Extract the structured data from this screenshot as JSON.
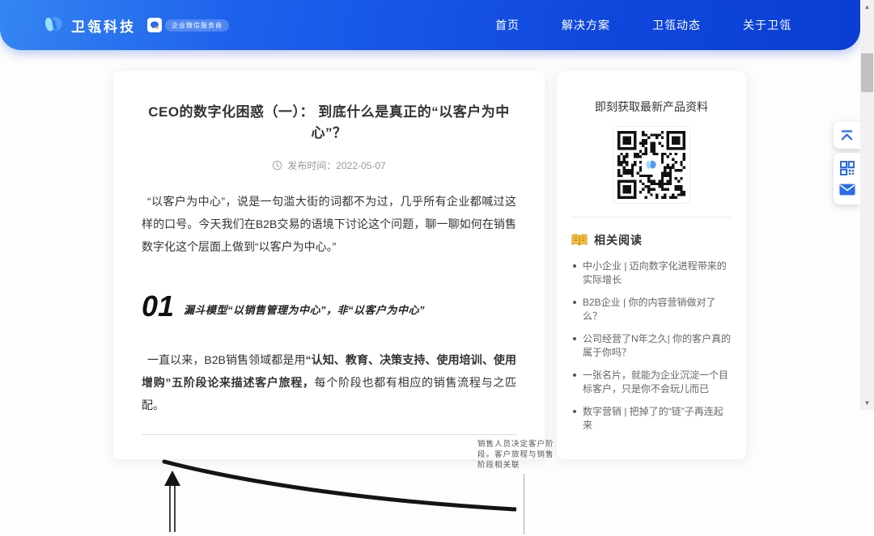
{
  "colors": {
    "header_gradient_start": "#3585f2",
    "header_gradient_end": "#0a3ed4",
    "accent_blue": "#2a6cea",
    "book_icon_gold": "#e8b339",
    "text_dark": "#333333",
    "text_gray": "#666666",
    "text_light": "#999999"
  },
  "icons": {
    "logo": "weiling-wing-mark",
    "badge": "wechat-work-bubble",
    "clock": "clock-outline",
    "book": "open-book",
    "qr": "qr-grid",
    "mail": "envelope",
    "back_top": "chevron-up-to-line",
    "scroll_up": "▲",
    "scroll_down": "▼"
  },
  "header": {
    "brand": "卫瓴科技",
    "badge": "企业微信服务商",
    "nav": [
      {
        "label": "首页"
      },
      {
        "label": "解决方案"
      },
      {
        "label": "卫瓴动态"
      },
      {
        "label": "关于卫瓴"
      }
    ]
  },
  "article": {
    "title": "CEO的数字化困惑（一）： 到底什么是真正的“以客户为中心”？",
    "publish_label": "发布时间：2022-05-07",
    "para1": "“以客户为中心”，说是一句滥大街的词都不为过，几乎所有企业都喊过这样的口号。今天我们在B2B交易的语境下讨论这个问题，聊一聊如何在销售数字化这个层面上做到“以客户为中心。”",
    "section_number": "01",
    "section_title": "漏斗模型“以销售管理为中心”，非“以客户为中心”",
    "para2_normal1": "一直以来，B2B销售领域都是用",
    "para2_bold": "“认知、教育、决策支持、使用培训、使用增购”五阶段论来描述客户旅程，",
    "para2_normal2": "每个阶段也都有相应的销售流程与之匹配。",
    "chart_annotation": "销售人员决定客户阶段。客户旅程与销售阶段相关联"
  },
  "chart_data": {
    "type": "line",
    "title": "",
    "description": "漏斗模型示意图：一条向右下方递减的粗黑曲线，左侧有向上箭头，右侧标注销售阶段与客户旅程的关联",
    "series": [
      {
        "name": "漏斗曲线",
        "values": [
          100,
          82,
          68,
          58,
          51,
          46,
          43
        ]
      }
    ],
    "x": [
      0,
      1,
      2,
      3,
      4,
      5,
      6
    ],
    "annotations": [
      "销售人员决定客户阶段。客户旅程与销售阶段相关联"
    ],
    "grid": false,
    "legend": false
  },
  "sidebar": {
    "qr_title": "即刻获取最新产品资料",
    "related_title": "相关阅读",
    "related_items": [
      "中小企业 | 迈向数字化进程带来的实际增长",
      "B2B企业 | 你的内容营销做对了么？",
      "公司经营了N年之久| 你的客户真的属于你吗？",
      "一张名片，就能为企业沉淀一个目标客户，只是你不会玩儿而已",
      "数字营销 | 把掉了的“链”子再连起来"
    ]
  }
}
